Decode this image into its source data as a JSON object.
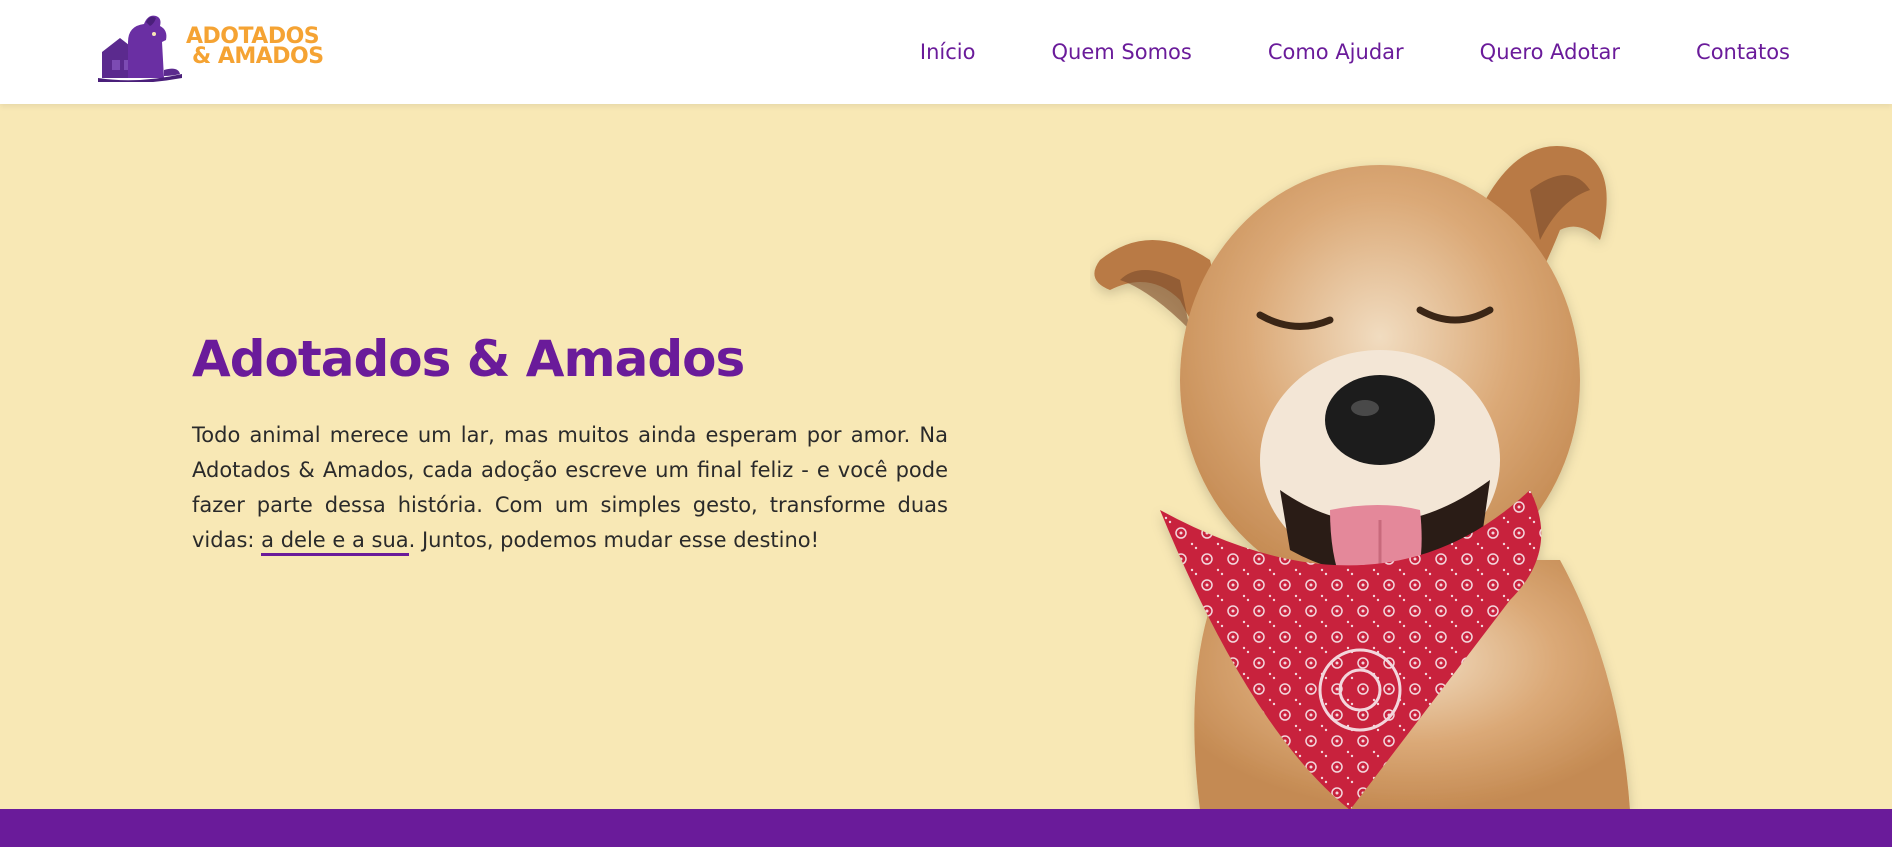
{
  "header": {
    "logo": {
      "line1": "ADOTADOS",
      "line2": "& AMADOS"
    },
    "nav": [
      {
        "label": "Início"
      },
      {
        "label": "Quem Somos"
      },
      {
        "label": "Como Ajudar"
      },
      {
        "label": "Quero Adotar"
      },
      {
        "label": "Contatos"
      }
    ]
  },
  "hero": {
    "title": "Adotados & Amados",
    "text_before": "Todo animal merece um lar, mas muitos ainda esperam por amor. Na Adotados & Amados, cada adoção escreve um final feliz - e você pode fazer parte dessa história. Com um simples gesto, transforme duas vidas: ",
    "text_highlight": "a dele e a sua",
    "text_after": ". Juntos, podemos mudar esse destino!"
  },
  "icons": {
    "logo_mark": "dog-house-logo-icon"
  },
  "colors": {
    "brand_purple": "#6a1b9a",
    "brand_orange": "#f5a333",
    "hero_bg": "#f8e8b5",
    "bandana_red": "#c8213c"
  }
}
